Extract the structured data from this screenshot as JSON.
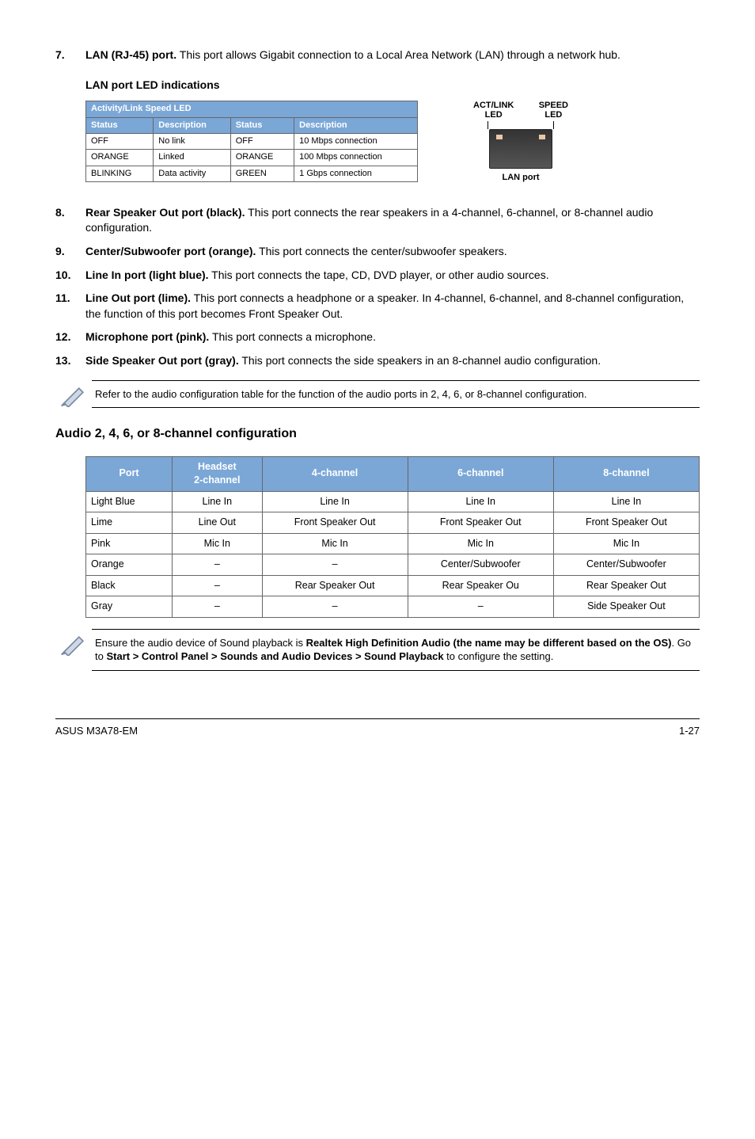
{
  "items": {
    "i7": {
      "num": "7.",
      "title": "LAN (RJ-45) port.",
      "body": " This port allows Gigabit connection to a Local Area Network (LAN) through a network hub."
    },
    "lan_head": "LAN port LED indications",
    "i8": {
      "num": "8.",
      "title": "Rear Speaker Out port (black).",
      "body": " This port connects the rear speakers in a 4-channel, 6-channel, or 8-channel audio configuration."
    },
    "i9": {
      "num": "9.",
      "title": "Center/Subwoofer port (orange).",
      "body": " This port connects the center/subwoofer speakers."
    },
    "i10": {
      "num": "10.",
      "title": "Line In port (light blue).",
      "body": " This port connects the tape, CD, DVD player, or other audio sources."
    },
    "i11": {
      "num": "11.",
      "title": "Line Out port (lime).",
      "body": " This port connects a headphone or a speaker. In 4-channel, 6-channel, and 8-channel configuration, the function of this port becomes Front Speaker Out."
    },
    "i12": {
      "num": "12.",
      "title": "Microphone port (pink).",
      "body": " This port connects a microphone."
    },
    "i13": {
      "num": "13.",
      "title": "Side Speaker Out port (gray).",
      "body": " This port connects the side speakers in an 8-channel audio configuration."
    }
  },
  "lan_table": {
    "title": "Activity/Link Speed LED",
    "h1": "Status",
    "h2": "Description",
    "h3": "Status",
    "h4": "Description",
    "rows": [
      {
        "c1": "OFF",
        "c2": "No link",
        "c3": "OFF",
        "c4": "10 Mbps connection"
      },
      {
        "c1": "ORANGE",
        "c2": "Linked",
        "c3": "ORANGE",
        "c4": "100 Mbps connection"
      },
      {
        "c1": "BLINKING",
        "c2": "Data activity",
        "c3": "GREEN",
        "c4": "1 Gbps connection"
      }
    ]
  },
  "lan_diag": {
    "l1a": "ACT/LINK",
    "l1b": "LED",
    "l2a": "SPEED",
    "l2b": "LED",
    "caption": "LAN port"
  },
  "note1": "Refer to the audio configuration table for the function of the audio ports in 2, 4, 6, or 8-channel configuration.",
  "audio_head": "Audio 2, 4, 6, or 8-channel configuration",
  "audio_table": {
    "h": {
      "c1": "Port",
      "c2a": "Headset",
      "c2b": "2-channel",
      "c3": "4-channel",
      "c4": "6-channel",
      "c5": "8-channel"
    },
    "rows": [
      {
        "c1": "Light Blue",
        "c2": "Line In",
        "c3": "Line In",
        "c4": "Line In",
        "c5": "Line In"
      },
      {
        "c1": "Lime",
        "c2": "Line Out",
        "c3": "Front Speaker Out",
        "c4": "Front Speaker Out",
        "c5": "Front Speaker Out"
      },
      {
        "c1": "Pink",
        "c2": "Mic In",
        "c3": "Mic In",
        "c4": "Mic In",
        "c5": "Mic In"
      },
      {
        "c1": "Orange",
        "c2": "–",
        "c3": "–",
        "c4": "Center/Subwoofer",
        "c5": "Center/Subwoofer"
      },
      {
        "c1": "Black",
        "c2": "–",
        "c3": "Rear Speaker Out",
        "c4": "Rear Speaker Ou",
        "c5": "Rear Speaker Out"
      },
      {
        "c1": "Gray",
        "c2": "–",
        "c3": "–",
        "c4": "–",
        "c5": "Side Speaker Out"
      }
    ]
  },
  "note2": {
    "p1": "Ensure the audio device of Sound playback is ",
    "b1": "Realtek High Definition Audio (the name may be different based on the OS)",
    "p2": ". Go to ",
    "b2": "Start > Control Panel > Sounds and Audio Devices > Sound Playback",
    "p3": " to configure the setting."
  },
  "footer": {
    "left": "ASUS M3A78-EM",
    "right": "1-27"
  }
}
